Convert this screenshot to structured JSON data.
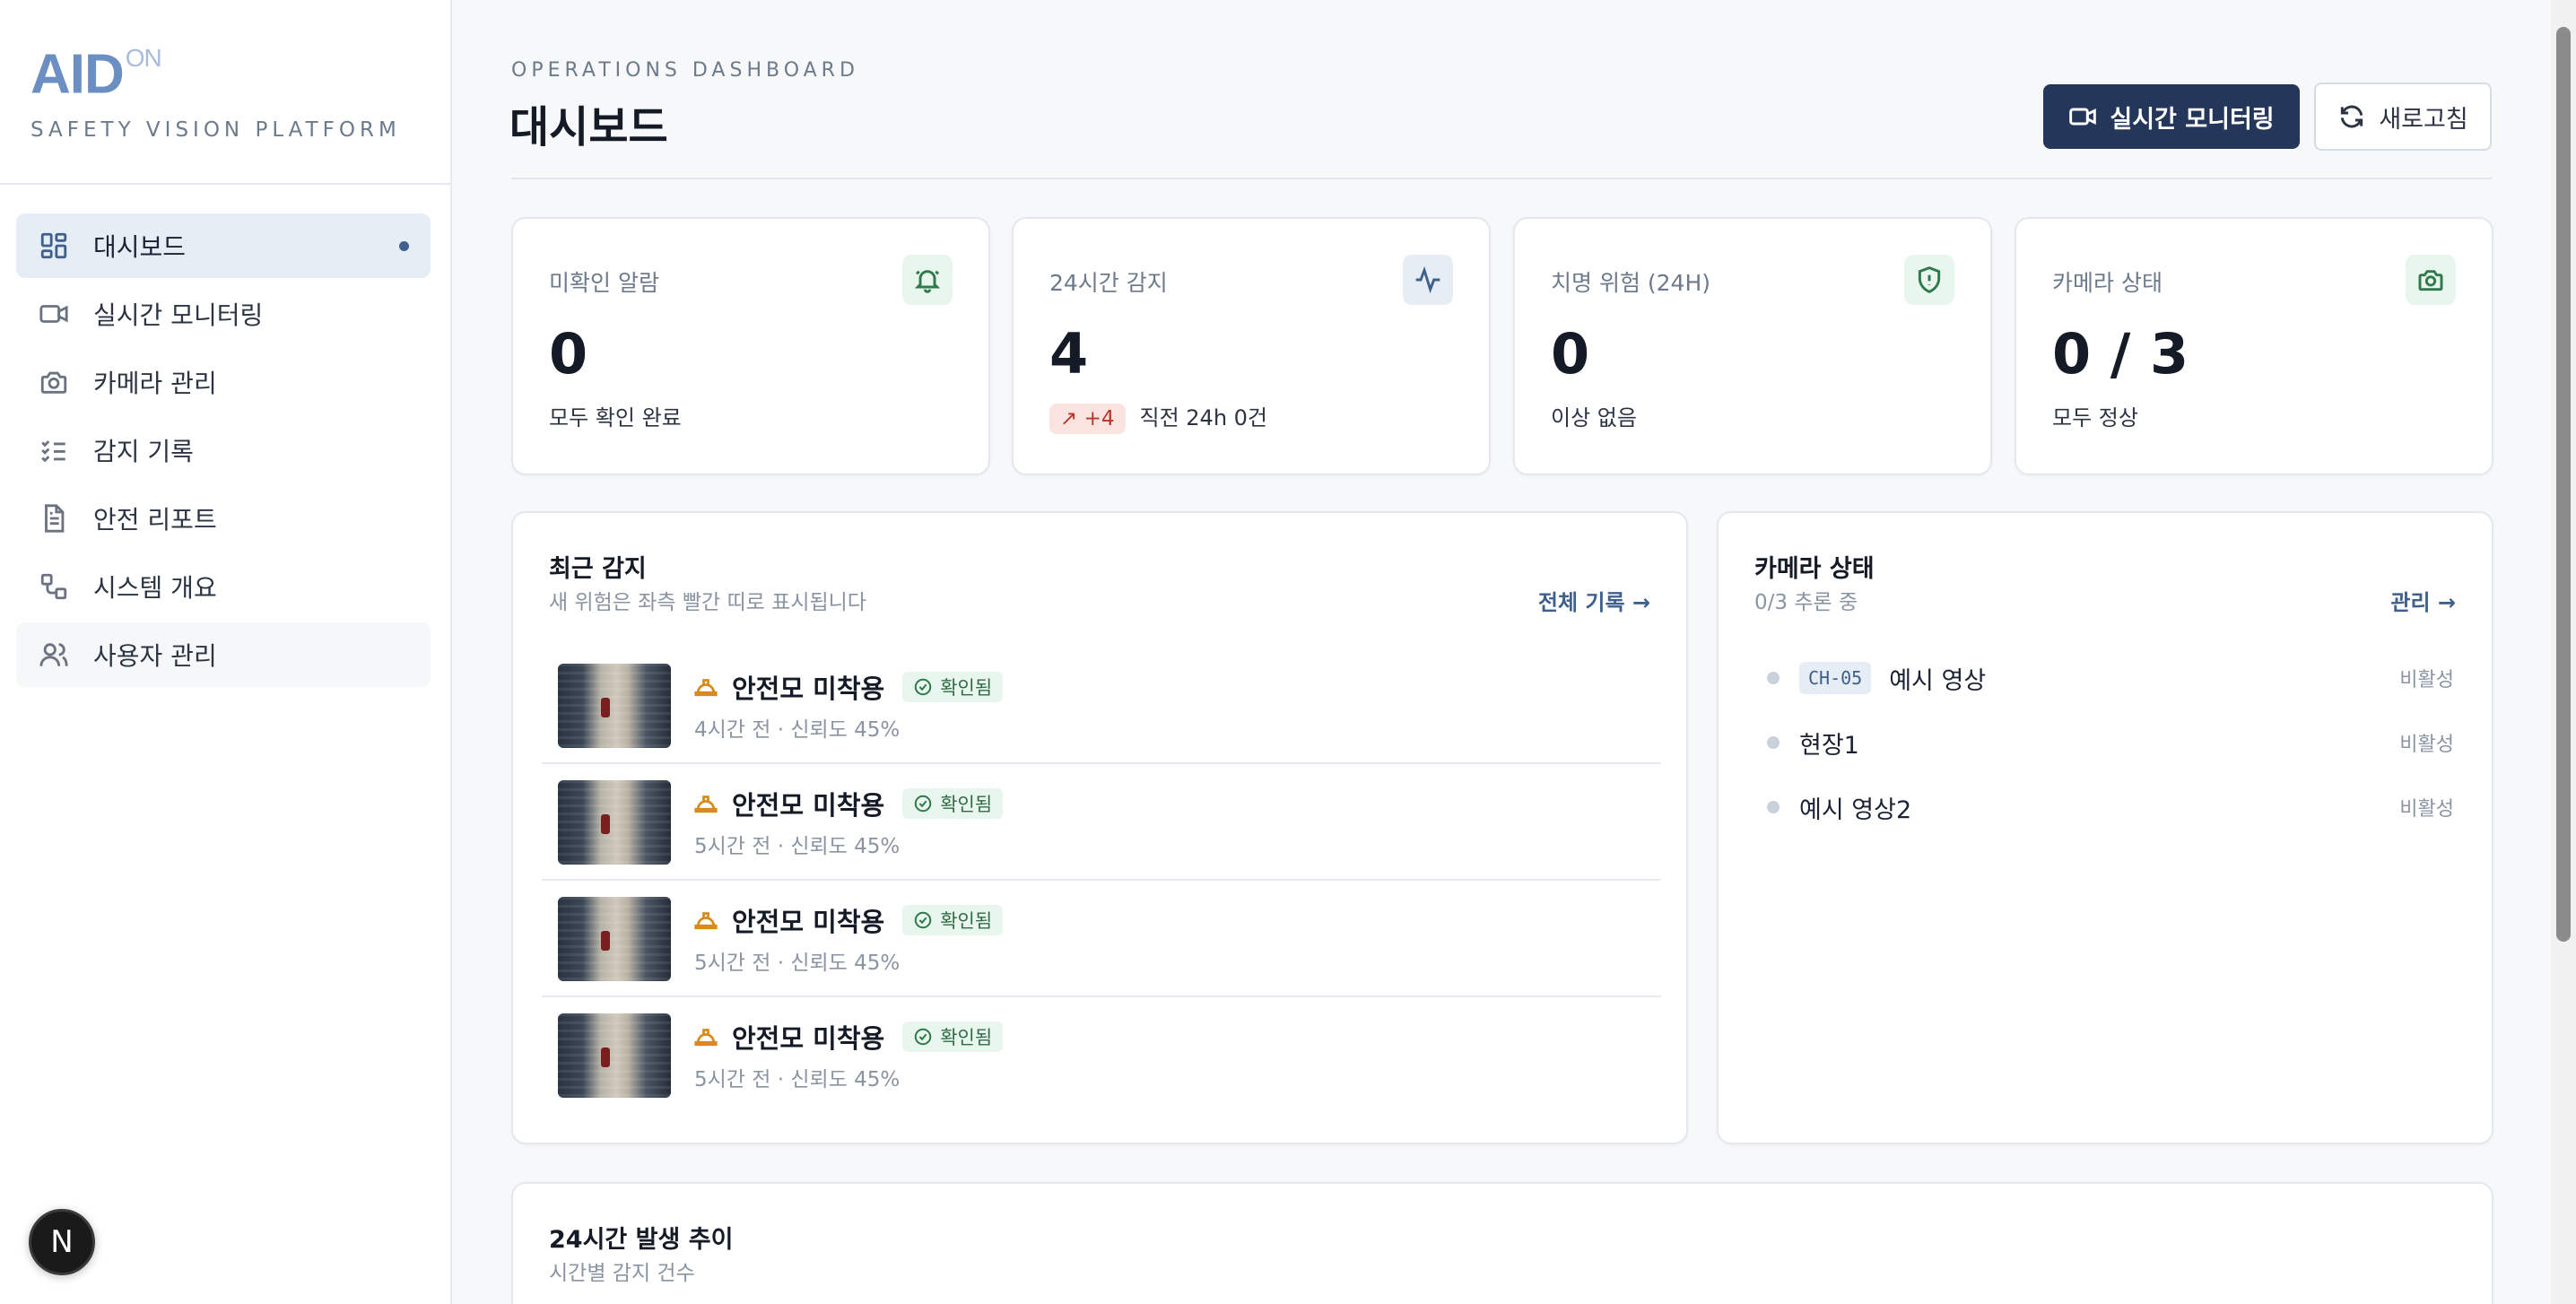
{
  "brand": {
    "logo": "AID",
    "logo_sup": "ON",
    "tagline": "SAFETY VISION PLATFORM"
  },
  "sidebar": {
    "items": [
      {
        "label": "대시보드",
        "icon": "grid-icon"
      },
      {
        "label": "실시간 모니터링",
        "icon": "video-icon"
      },
      {
        "label": "카메라 관리",
        "icon": "camera-icon"
      },
      {
        "label": "감지 기록",
        "icon": "list-check-icon"
      },
      {
        "label": "안전 리포트",
        "icon": "document-icon"
      },
      {
        "label": "시스템 개요",
        "icon": "workflow-icon"
      },
      {
        "label": "사용자 관리",
        "icon": "users-icon"
      }
    ],
    "footer_badge": "N"
  },
  "header": {
    "eyebrow": "OPERATIONS DASHBOARD",
    "title": "대시보드",
    "primary_button": "실시간 모니터링",
    "secondary_button": "새로고침"
  },
  "stats": [
    {
      "label": "미확인 알람",
      "value": "0",
      "sub": "모두 확인 완료",
      "icon": "bell-icon"
    },
    {
      "label": "24시간 감지",
      "value": "4",
      "delta": "↗ +4",
      "sub": "직전 24h 0건",
      "icon": "activity-icon"
    },
    {
      "label": "치명 위험 (24H)",
      "value": "0",
      "sub": "이상 없음",
      "icon": "shield-alert-icon"
    },
    {
      "label": "카메라 상태",
      "value": "0 / 3",
      "sub": "모두 정상",
      "icon": "camera-icon"
    }
  ],
  "recent": {
    "title": "최근 감지",
    "subtitle": "새 위험은 좌측 빨간 띠로 표시됩니다",
    "link": "전체 기록 →",
    "items": [
      {
        "name": "안전모 미착용",
        "badge": "확인됨",
        "meta": "4시간 전 · 신뢰도 45%"
      },
      {
        "name": "안전모 미착용",
        "badge": "확인됨",
        "meta": "5시간 전 · 신뢰도 45%"
      },
      {
        "name": "안전모 미착용",
        "badge": "확인됨",
        "meta": "5시간 전 · 신뢰도 45%"
      },
      {
        "name": "안전모 미착용",
        "badge": "확인됨",
        "meta": "5시간 전 · 신뢰도 45%"
      }
    ]
  },
  "cameras": {
    "title": "카메라 상태",
    "subtitle": "0/3 추론 중",
    "link": "관리 →",
    "items": [
      {
        "code": "CH-05",
        "name": "예시 영상",
        "status": "비활성"
      },
      {
        "code": "",
        "name": "현장1",
        "status": "비활성"
      },
      {
        "code": "",
        "name": "예시 영상2",
        "status": "비활성"
      }
    ]
  },
  "trend": {
    "title": "24시간 발생 추이",
    "subtitle": "시간별 감지 건수"
  },
  "colors": {
    "accent": "#24365a",
    "brand": "#6b8fc3",
    "alert": "#b8372b",
    "ok": "#2f7a4c",
    "warn": "#d98a1a"
  }
}
